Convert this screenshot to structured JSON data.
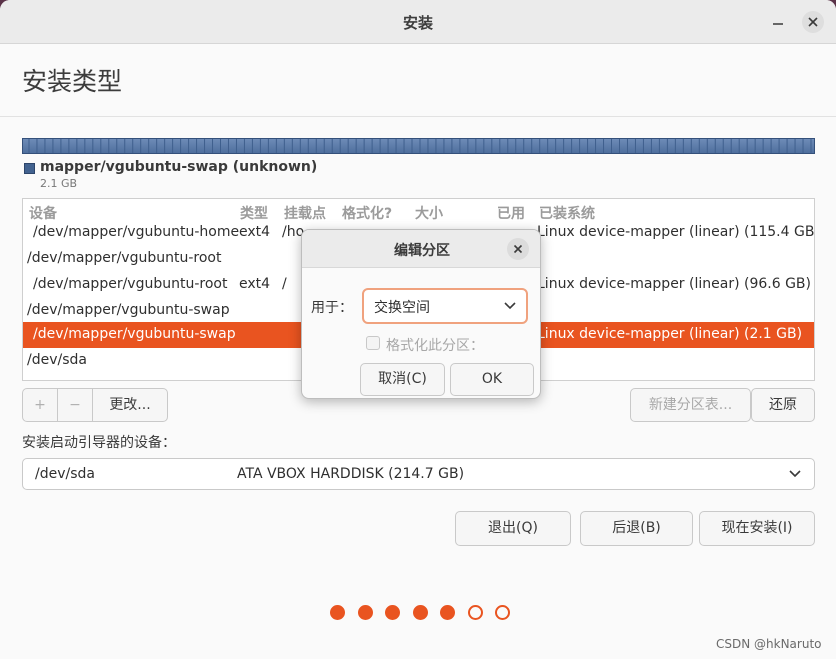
{
  "window": {
    "title": "安装"
  },
  "page": {
    "heading": "安装类型"
  },
  "partition_bar": {
    "color": "#4f6f9d",
    "legend_name": "mapper/vgubuntu-swap (unknown)",
    "legend_size": "2.1 GB"
  },
  "table": {
    "headers": {
      "device": "设备",
      "type": "类型",
      "mount": "挂载点",
      "format": "格式化?",
      "size": "大小",
      "used": "已用",
      "system": "已装系统"
    },
    "rows": [
      {
        "device": "/dev/mapper/vgubuntu-home",
        "type": "ext4",
        "mount": "/ho",
        "system": "Linux device-mapper (linear) (115.4 GB)"
      },
      {
        "device": "/dev/mapper/vgubuntu-root",
        "type": "",
        "mount": "",
        "system": ""
      },
      {
        "device": "/dev/mapper/vgubuntu-root",
        "type": "ext4",
        "mount": "/",
        "system": "Linux device-mapper (linear) (96.6 GB)"
      },
      {
        "device": "/dev/mapper/vgubuntu-swap",
        "type": "",
        "mount": "",
        "system": ""
      },
      {
        "device": "/dev/mapper/vgubuntu-swap",
        "type": "",
        "mount": "",
        "system": "Linux device-mapper (linear) (2.1 GB)"
      },
      {
        "device": "/dev/sda",
        "type": "",
        "mount": "",
        "system": ""
      }
    ],
    "selected_color": "#e95420"
  },
  "actions": {
    "add": "+",
    "remove": "−",
    "change": "更改...",
    "new_table": "新建分区表...",
    "revert": "还原"
  },
  "bootloader": {
    "label": "安装启动引导器的设备：",
    "device": "/dev/sda",
    "description": "ATA VBOX HARDDISK (214.7 GB)"
  },
  "nav": {
    "quit": "退出(Q)",
    "back": "后退(B)",
    "install": "现在安装(I)"
  },
  "progress": {
    "steps_done": 5,
    "steps_total": 7,
    "color": "#e95420"
  },
  "watermark": "CSDN @hkNaruto",
  "dialog": {
    "title": "编辑分区",
    "use_label": "用于：",
    "use_value": "交换空间",
    "format_label": "格式化此分区：",
    "cancel": "取消(C)",
    "ok": "OK"
  }
}
